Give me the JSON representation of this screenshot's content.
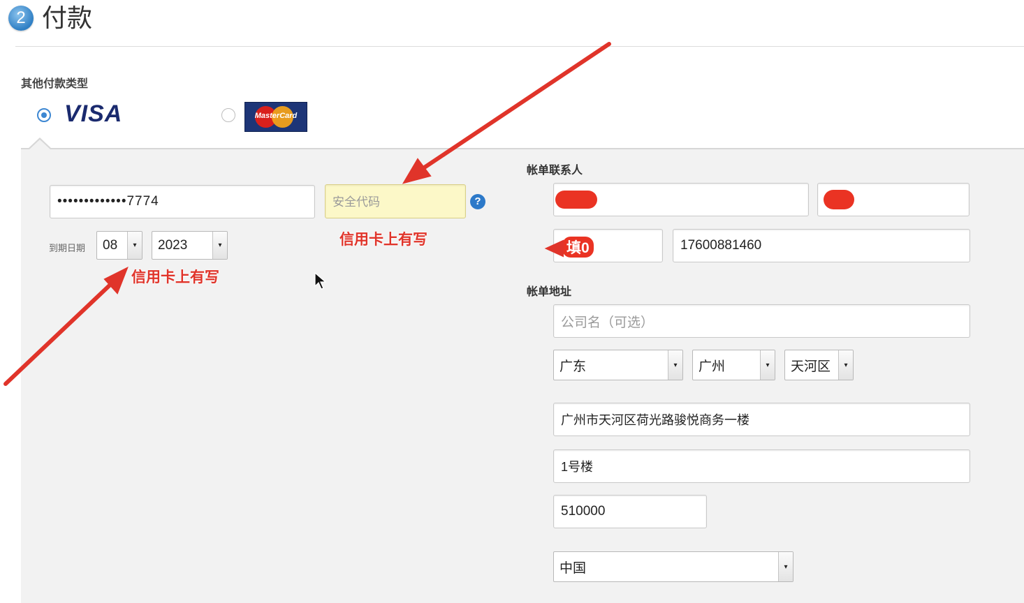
{
  "header": {
    "step_number": "2",
    "title": "付款"
  },
  "payment": {
    "other_types_label": "其他付款类型",
    "options": [
      {
        "brand": "VISA",
        "selected": true
      },
      {
        "brand": "MasterCard",
        "selected": false
      }
    ]
  },
  "card": {
    "number_value": "•••••••••••••7774",
    "security_code_placeholder": "安全代码",
    "expiry_label": "到期日期",
    "expiry_month": "08",
    "expiry_year": "2023",
    "help_icon_glyph": "?"
  },
  "annotations": {
    "security_note": "信用卡上有写",
    "expiry_note": "信用卡上有写",
    "phone_note": "填0"
  },
  "billing_contact": {
    "label": "帐单联系人",
    "phone_value": "17600881460"
  },
  "billing_address": {
    "label": "帐单地址",
    "company_placeholder": "公司名（可选）",
    "province": "广东",
    "city": "广州",
    "district": "天河区",
    "street_line1": "广州市天河区荷光路骏悦商务一楼",
    "street_line2": "1号楼",
    "postal_code": "510000",
    "country": "中国"
  },
  "colors": {
    "accent_blue": "#3d87d2",
    "annotation_red": "#e0342a",
    "panel_gray": "#f2f2f2",
    "highlight_yellow": "#fcf8c8"
  }
}
